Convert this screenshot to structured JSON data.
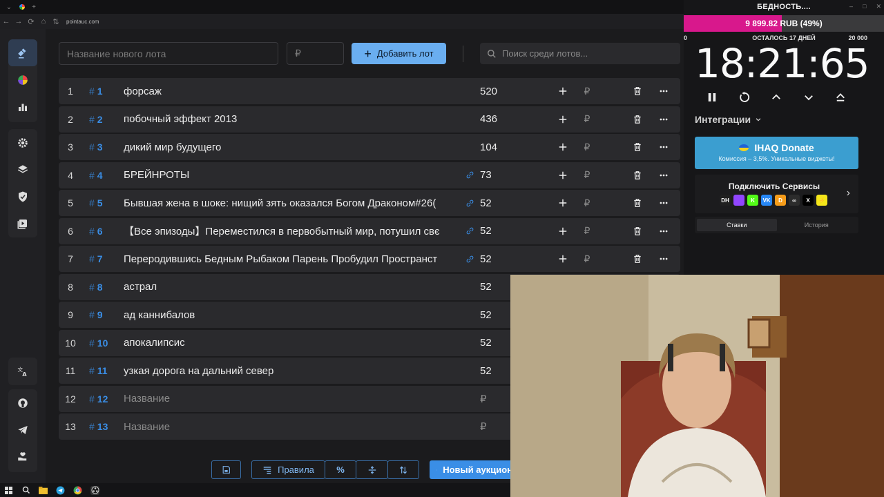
{
  "browser": {
    "url": "pointauc.com"
  },
  "form": {
    "name_placeholder": "Название нового лота",
    "price_placeholder": "₽",
    "add_label": "Добавить лот",
    "search_placeholder": "Поиск среди лотов..."
  },
  "lots": [
    {
      "num": "1",
      "id": "1",
      "name": "форсаж",
      "amount": "520",
      "link": false,
      "placeholder": false
    },
    {
      "num": "2",
      "id": "2",
      "name": "побочный эффект 2013",
      "amount": "436",
      "link": false,
      "placeholder": false
    },
    {
      "num": "3",
      "id": "3",
      "name": "дикий мир будущего",
      "amount": "104",
      "link": false,
      "placeholder": false
    },
    {
      "num": "4",
      "id": "4",
      "name": "БРЕЙНРОТЫ",
      "amount": "73",
      "link": true,
      "placeholder": false
    },
    {
      "num": "5",
      "id": "5",
      "name": "Бывшая жена в шоке: нищий зять оказался Богом Драконом#26(",
      "amount": "52",
      "link": true,
      "placeholder": false
    },
    {
      "num": "6",
      "id": "6",
      "name": "【Все эпизоды】Переместился в первобытный мир, потушил свє",
      "amount": "52",
      "link": true,
      "placeholder": false
    },
    {
      "num": "7",
      "id": "7",
      "name": "Переродившись Бедным Рыбаком Парень Пробудил Пространст",
      "amount": "52",
      "link": true,
      "placeholder": false
    },
    {
      "num": "8",
      "id": "8",
      "name": "астрал",
      "amount": "52",
      "link": false,
      "placeholder": false
    },
    {
      "num": "9",
      "id": "9",
      "name": "ад каннибалов",
      "amount": "52",
      "link": false,
      "placeholder": false
    },
    {
      "num": "10",
      "id": "10",
      "name": "апокалипсис",
      "amount": "52",
      "link": false,
      "placeholder": false
    },
    {
      "num": "11",
      "id": "11",
      "name": "узкая дорога на дальний север",
      "amount": "52",
      "link": false,
      "placeholder": false
    },
    {
      "num": "12",
      "id": "12",
      "name": "Название",
      "amount": "₽",
      "link": false,
      "placeholder": true
    },
    {
      "num": "13",
      "id": "13",
      "name": "Название",
      "amount": "₽",
      "link": false,
      "placeholder": true
    }
  ],
  "row_currency": "₽",
  "toolbar": {
    "rules_label": "Правила",
    "new_auction_label": "Новый аукцион"
  },
  "goal": {
    "window_title": "БЕДНОСТЬ....",
    "progress_text": "9 899.82 RUB (49%)",
    "progress_fraction": 0.49,
    "min": "0",
    "days_left": "ОСТАЛОСЬ 17 ДНЕЙ",
    "max": "20 000",
    "fill_color": "#d8188c"
  },
  "timer": {
    "value": "18:21:65"
  },
  "integrations": {
    "label": "Интеграции",
    "donate_title": "IHAQ Donate",
    "donate_sub": "Комиссия – 3,5%. Уникальные виджеты!",
    "services_title": "Подключить Сервисы",
    "service_icons": [
      {
        "text": "DH",
        "color": "#202020"
      },
      {
        "text": "",
        "color": "#9146ff"
      },
      {
        "text": "K",
        "color": "#53fc18"
      },
      {
        "text": "VK",
        "color": "#2787f5"
      },
      {
        "text": "D",
        "color": "#f59c1a"
      },
      {
        "text": "∞",
        "color": "#2c2c2c"
      },
      {
        "text": "X",
        "color": "#000000"
      },
      {
        "text": "⚡",
        "color": "#f5e61a"
      }
    ]
  },
  "history_tabs": {
    "bets": "Ставки",
    "history": "История"
  },
  "colors": {
    "accent": "#3a8ee6",
    "add_button": "#6aaef0",
    "donate": "#3b9ed0"
  }
}
